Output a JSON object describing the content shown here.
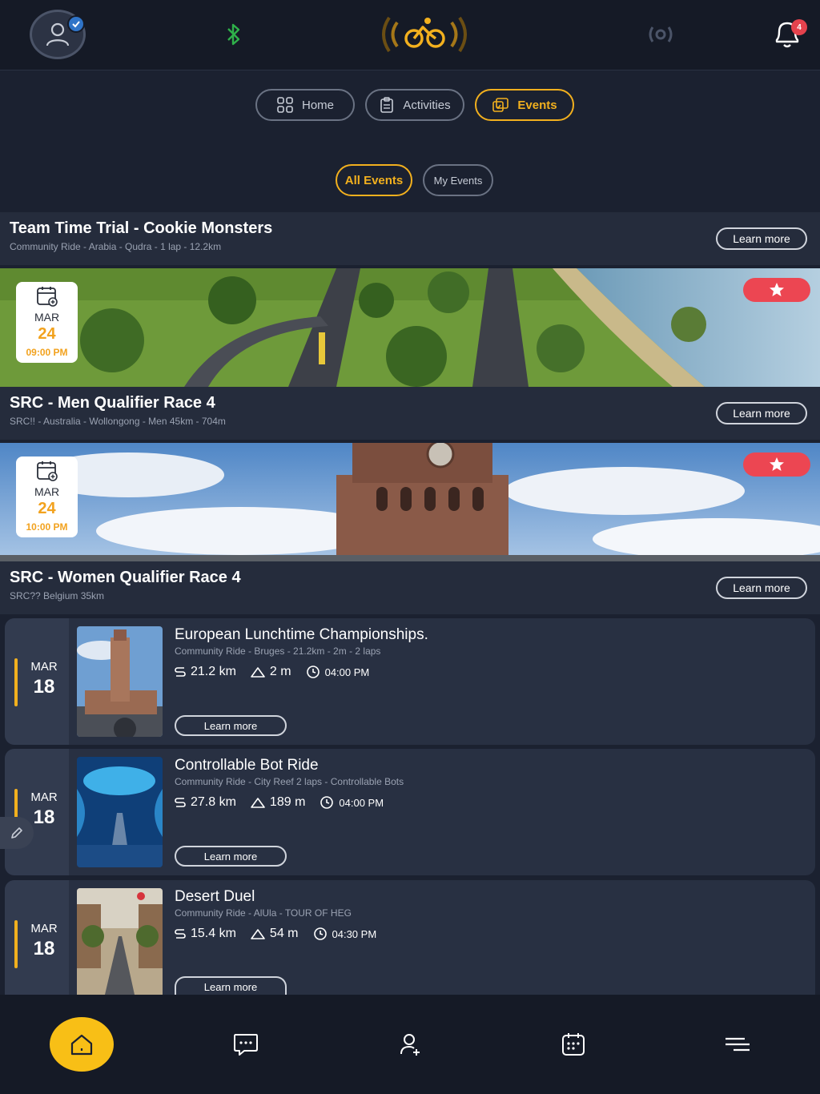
{
  "topbar": {
    "notification_count": "4",
    "icons": [
      "user-avatar-icon",
      "verified-check-icon",
      "bluetooth-icon",
      "cyclist-logo-icon",
      "sensor-icon",
      "bell-icon"
    ]
  },
  "nav": {
    "tabs": [
      {
        "label": "Home",
        "icon": "grid-icon",
        "active": false
      },
      {
        "label": "Activities",
        "icon": "clipboard-icon",
        "active": false
      },
      {
        "label": "Events",
        "icon": "events-icon",
        "active": true
      }
    ],
    "subtabs": [
      {
        "label": "All Events",
        "active": true
      },
      {
        "label": "My Events",
        "active": false
      }
    ]
  },
  "featured": [
    {
      "title": "Team Time Trial - Cookie Monsters",
      "subtitle": "Community Ride - Arabia - Qudra - 1 lap - 12.2km",
      "learn_more": "Learn more"
    },
    {
      "title": "SRC - Men Qualifier Race 4",
      "subtitle": "SRC!! - Australia - Wollongong - Men 45km - 704m",
      "learn_more": "Learn more",
      "date": {
        "month": "MAR",
        "day": "24",
        "time": "09:00 PM"
      }
    },
    {
      "title": "SRC - Women Qualifier Race 4",
      "subtitle": "SRC?? Belgium 35km",
      "learn_more": "Learn more",
      "date": {
        "month": "MAR",
        "day": "24",
        "time": "10:00 PM"
      }
    }
  ],
  "events": [
    {
      "month": "MAR",
      "day": "18",
      "title": "European Lunchtime Championships.",
      "subtitle": "Community Ride - Bruges - 21.2km - 2m - 2 laps",
      "distance": "21.2 km",
      "elevation": "2 m",
      "time": "04:00 PM",
      "learn_more": "Learn more"
    },
    {
      "month": "MAR",
      "day": "18",
      "title": "Controllable Bot Ride",
      "subtitle": "Community Ride - City Reef 2 laps - Controllable Bots",
      "distance": "27.8 km",
      "elevation": "189 m",
      "time": "04:00 PM",
      "learn_more": "Learn more"
    },
    {
      "month": "MAR",
      "day": "18",
      "title": "Desert Duel",
      "subtitle": "Community Ride - AlUla - TOUR OF HEG",
      "distance": "15.4 km",
      "elevation": "54 m",
      "time": "04:30 PM",
      "learn_more": "Learn more"
    }
  ],
  "bottombar": {
    "items": [
      "home-icon",
      "chat-icon",
      "add-user-icon",
      "calendar-icon",
      "menu-icon"
    ]
  },
  "colors": {
    "accent": "#f2b01e",
    "favorite": "#ec4652",
    "background": "#1b2130"
  }
}
